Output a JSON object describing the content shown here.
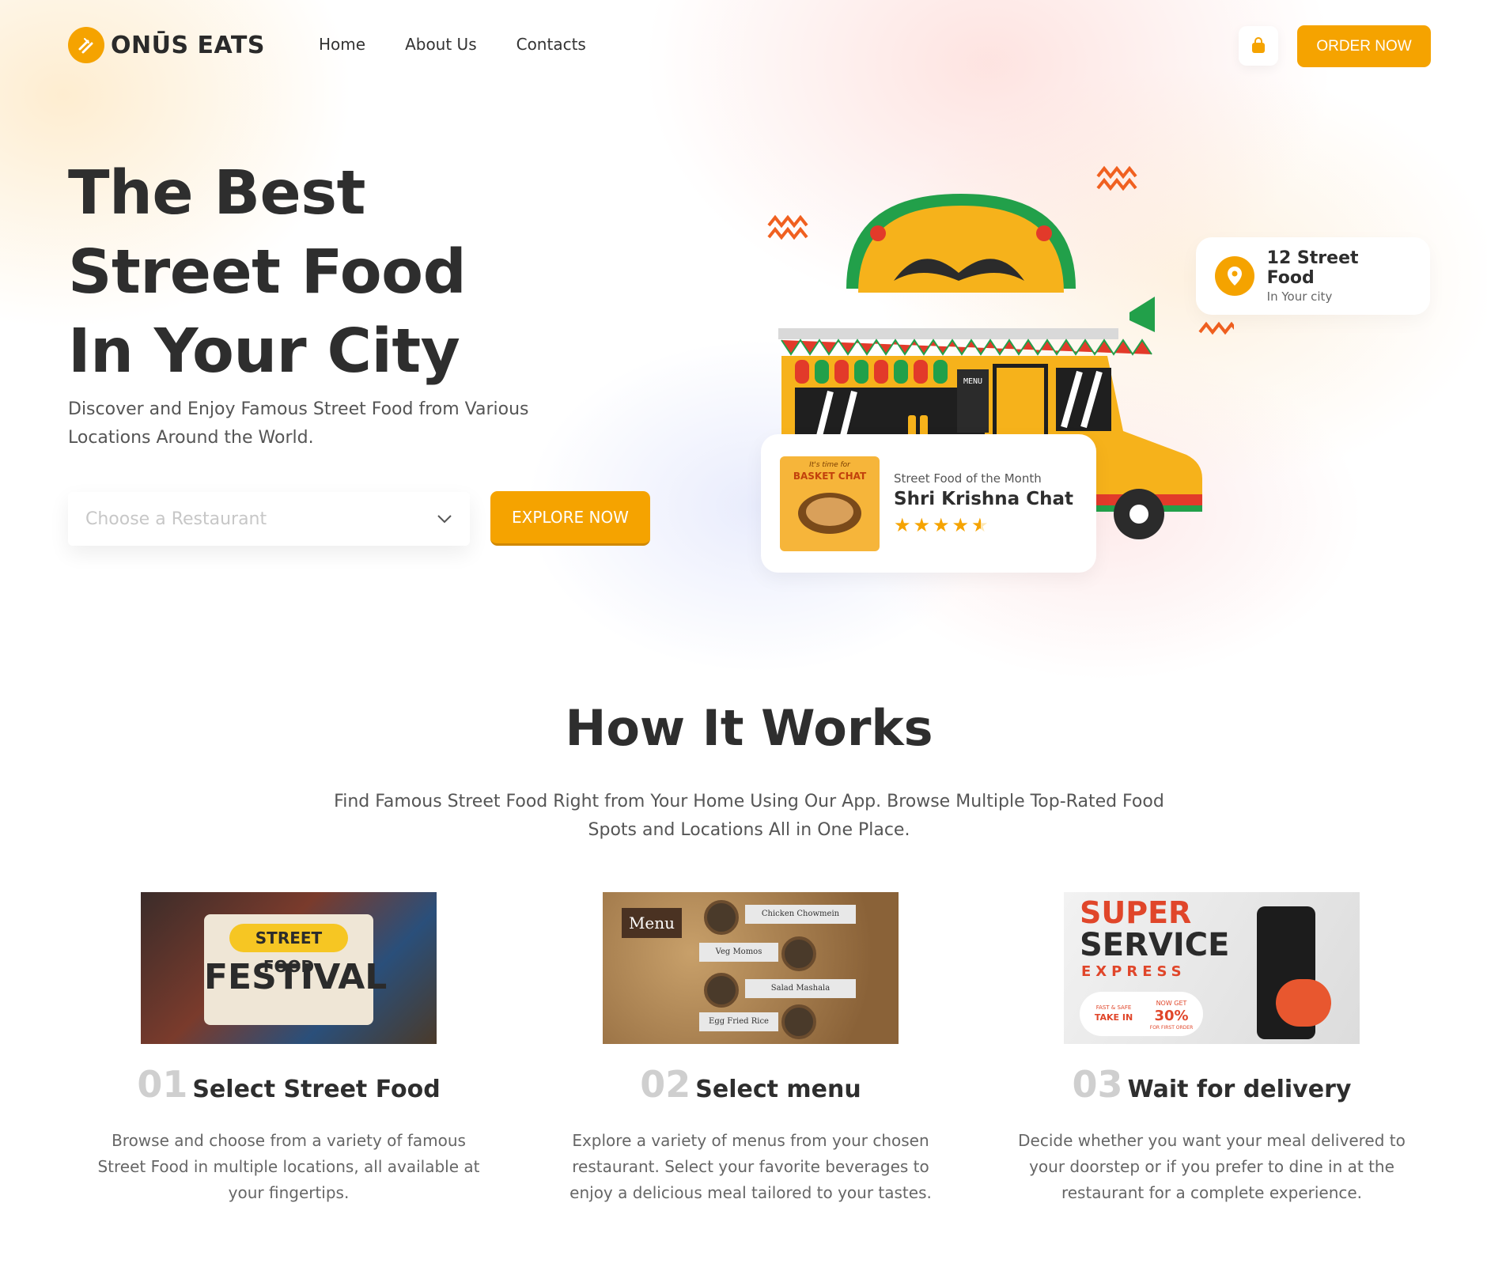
{
  "brand": {
    "name": "ONŪS EATS",
    "accent": "#f5a300"
  },
  "nav": {
    "items": [
      "Home",
      "About Us",
      "Contacts"
    ]
  },
  "header": {
    "order_label": "ORDER NOW"
  },
  "hero": {
    "title_line1": "The Best",
    "title_line2": "Street Food",
    "title_line3": "In Your City",
    "subtitle": "Discover and Enjoy Famous Street Food from Various Locations Around the World.",
    "select_placeholder": "Choose a Restaurant",
    "explore_label": "EXPLORE NOW"
  },
  "street_card": {
    "title": "12 Street Food",
    "subtitle": "In Your city"
  },
  "month_card": {
    "label": "Street Food of the Month",
    "name": "Shri Krishna Chat",
    "rating": 4.5,
    "thumb_caption_top": "It's time for",
    "thumb_caption": "BASKET CHAT"
  },
  "truck": {
    "menu_label": "MENU"
  },
  "how_it_works": {
    "title": "How It Works",
    "subtitle": "Find Famous Street Food Right from Your Home Using Our App. Browse Multiple Top-Rated Food Spots and Locations All in One Place.",
    "steps": [
      {
        "num": "01",
        "title": "Select Street Food",
        "desc": "Browse and choose from a variety of famous Street Food in multiple locations, all available at your fingertips.",
        "img_text1": "STREET FOOD",
        "img_text2": "FESTIVAL"
      },
      {
        "num": "02",
        "title": "Select menu",
        "desc": "Explore a variety of menus from your chosen restaurant. Select your favorite beverages to enjoy a delicious meal tailored to your tastes.",
        "img_text1": "Menu",
        "img_items": [
          "Chicken Chowmein",
          "Veg Momos",
          "Salad Mashala",
          "Egg Fried Rice"
        ]
      },
      {
        "num": "03",
        "title": "Wait for delivery",
        "desc": "Decide whether you want your meal delivered to your doorstep or if you prefer to dine in at the restaurant for a complete experience.",
        "img_text1": "SUPER",
        "img_text2": "SERVICE",
        "img_text3": "EXPRESS",
        "img_text4": "TAKE IN",
        "img_text5": "30%",
        "img_text6": "NOW GET",
        "img_text7": "FOR FIRST ORDER",
        "img_text8": "FAST & SAFE"
      }
    ]
  }
}
